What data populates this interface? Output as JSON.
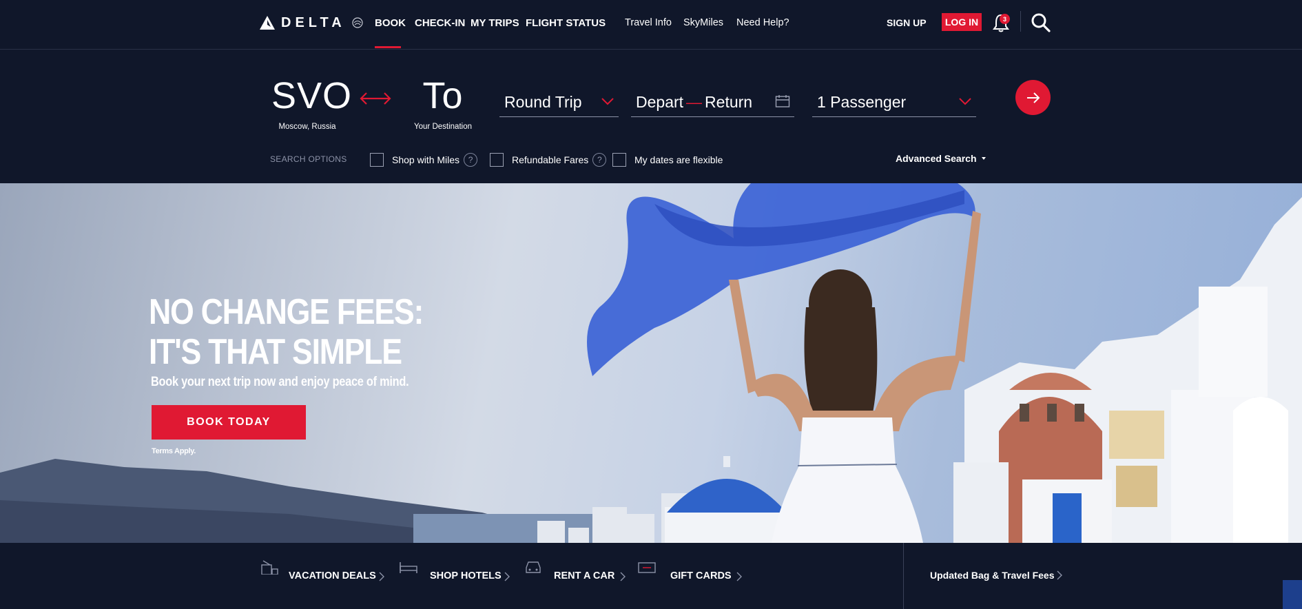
{
  "brand": {
    "name": "DELTA"
  },
  "nav": {
    "primary": [
      "BOOK",
      "CHECK-IN",
      "MY TRIPS",
      "FLIGHT STATUS"
    ],
    "secondary": [
      "Travel Info",
      "SkyMiles",
      "Need Help?"
    ],
    "sign_up": "SIGN UP",
    "log_in": "LOG IN",
    "notifications_count": "3",
    "active_tab": "BOOK"
  },
  "booking": {
    "from_code": "SVO",
    "from_city": "Moscow, Russia",
    "to_code": "To",
    "to_city": "Your Destination",
    "trip_type": "Round Trip",
    "depart": "Depart",
    "return": "Return",
    "passengers": "1 Passenger",
    "search_options_label": "SEARCH OPTIONS",
    "options": [
      "Shop with Miles",
      "Refundable Fares",
      "My dates are flexible"
    ],
    "advanced_search": "Advanced Search"
  },
  "hero": {
    "title_line1": "NO CHANGE FEES:",
    "title_line2": "IT'S THAT SIMPLE",
    "subtitle": "Book your next trip now and enjoy peace of mind.",
    "cta": "BOOK TODAY",
    "terms": "Terms Apply."
  },
  "strip": {
    "items": [
      "VACATION DEALS",
      "SHOP HOTELS",
      "RENT A CAR",
      "GIFT CARDS"
    ],
    "updated": "Updated Bag & Travel Fees"
  },
  "colors": {
    "navy": "#10172a",
    "red": "#e01933"
  }
}
